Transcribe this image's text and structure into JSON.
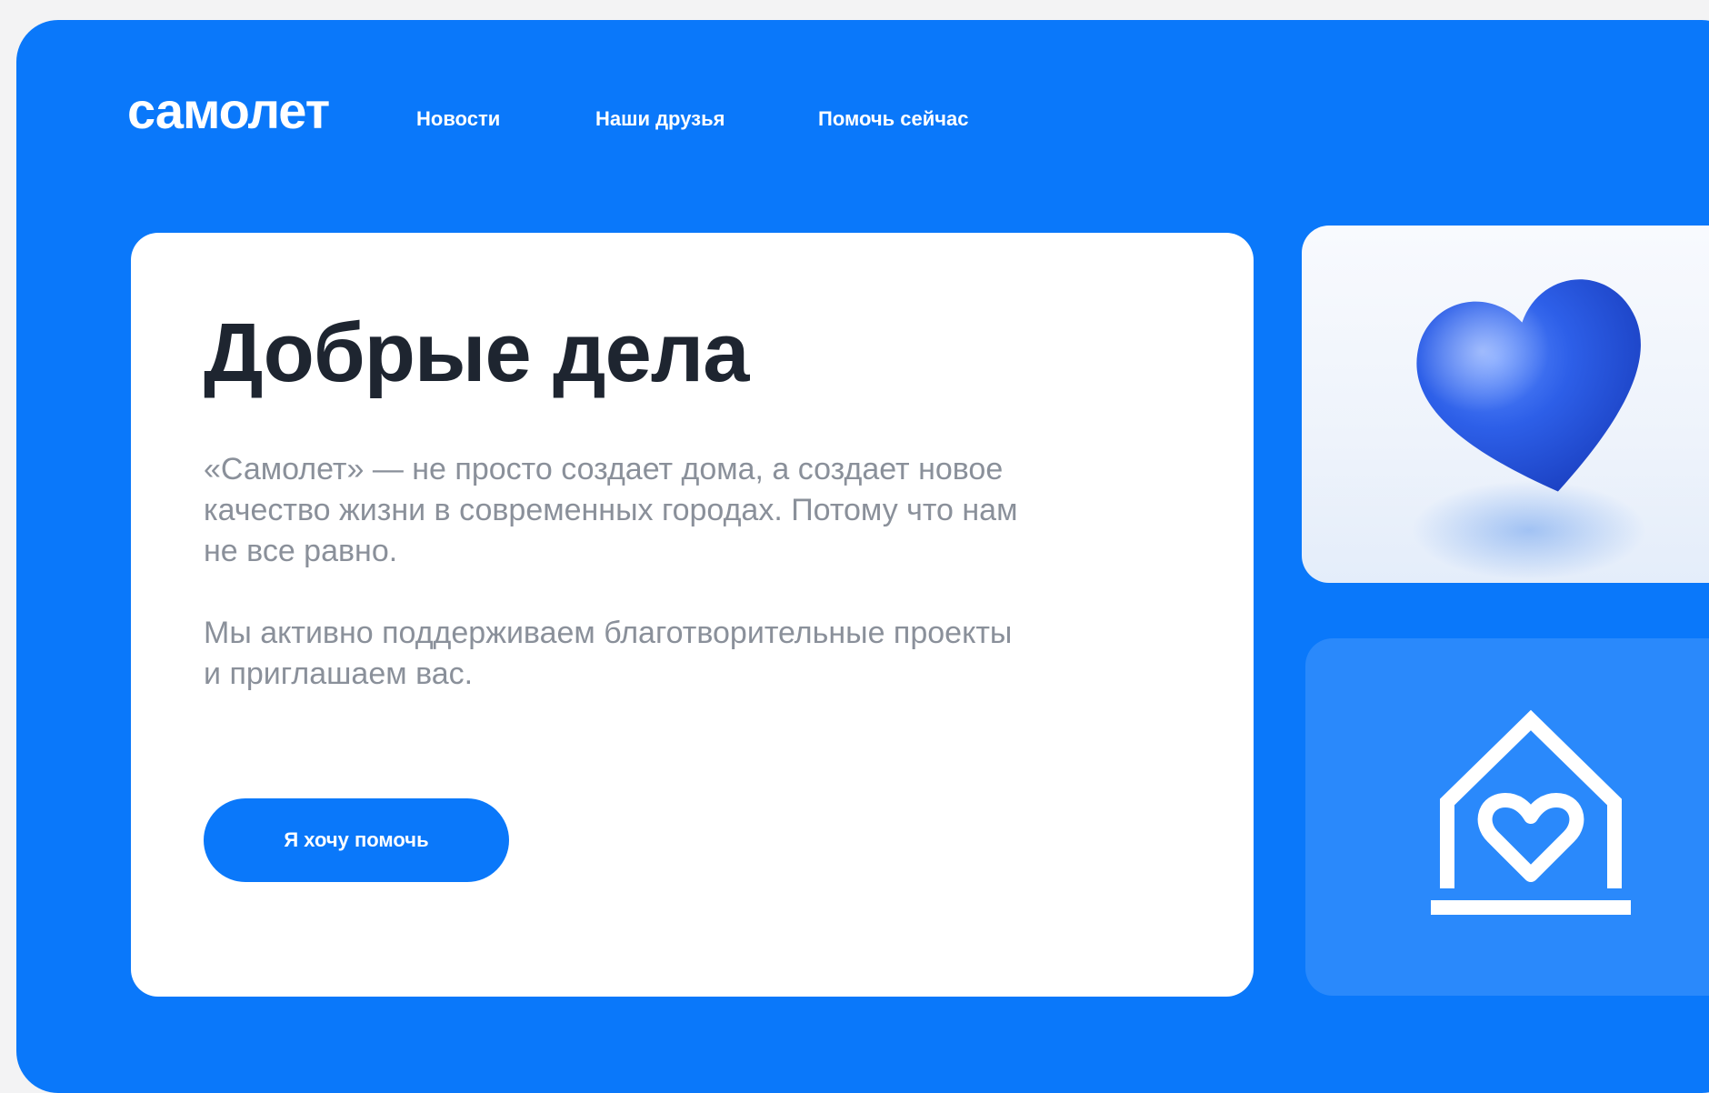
{
  "header": {
    "logo": "самолет",
    "nav": [
      {
        "label": "Новости"
      },
      {
        "label": "Наши друзья"
      },
      {
        "label": "Помочь сейчас"
      }
    ]
  },
  "hero": {
    "title": "Добрые дела",
    "paragraph1": "«Самолет» — не просто создает дома, а создает новое качество жизни в современных городах. Потому что нам не все равно.",
    "paragraph2": "Мы активно поддерживаем благотворительные проекты и приглашаем вас.",
    "cta_label": "Я хочу помочь"
  },
  "side_cards": {
    "heart_icon": "heart-3d-icon",
    "home_icon": "house-with-heart-icon"
  },
  "colors": {
    "brand_blue": "#0a78fa",
    "card_white": "#ffffff",
    "title_text": "#1e2530",
    "body_text": "#8a909a"
  }
}
